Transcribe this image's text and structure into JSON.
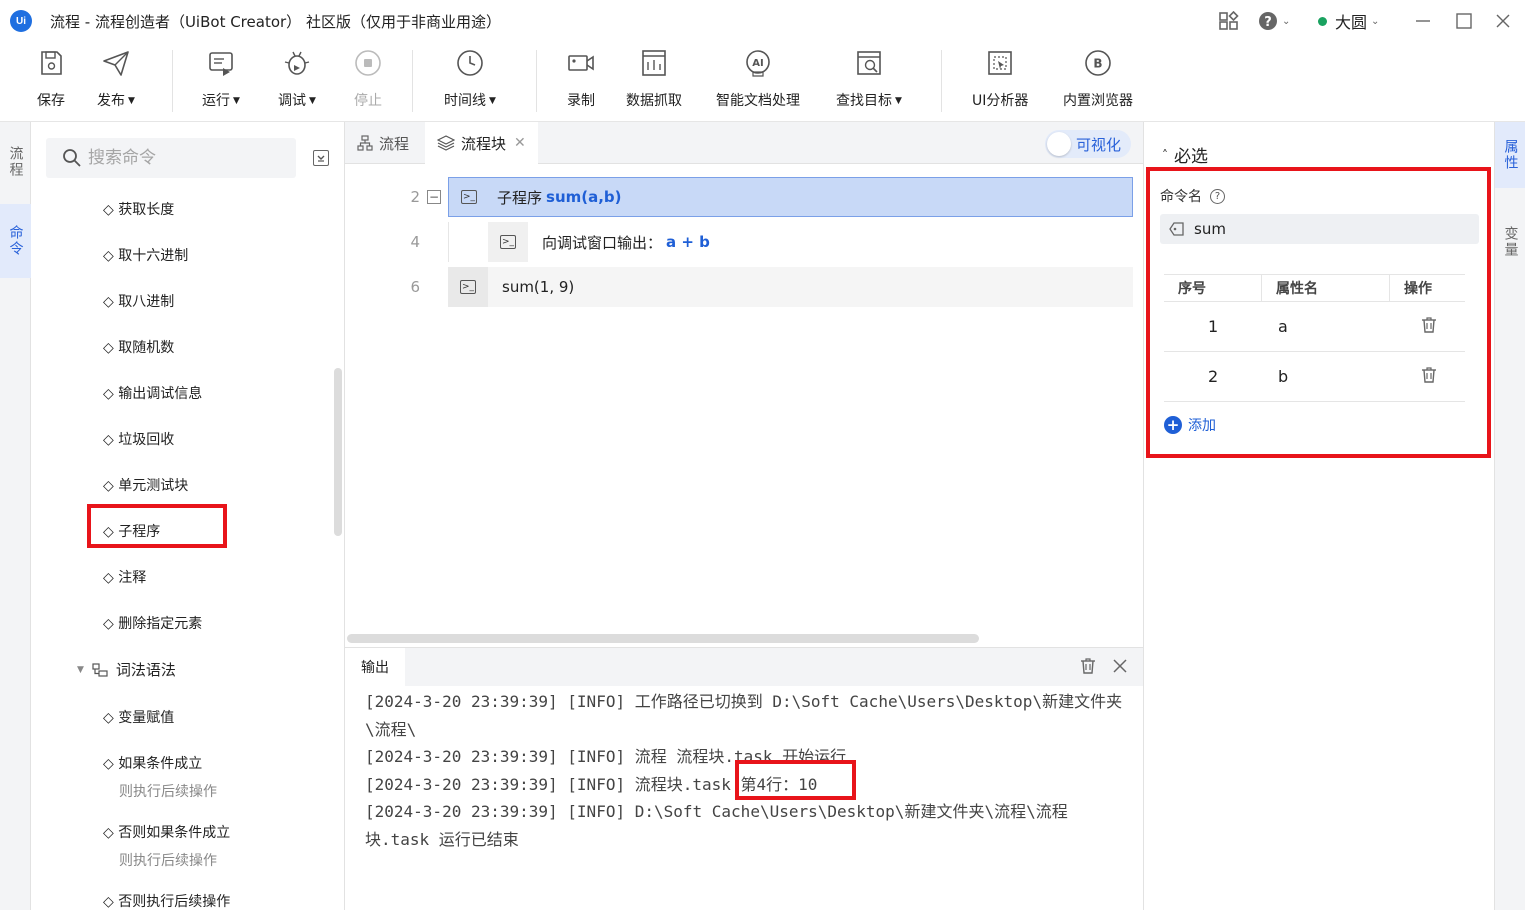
{
  "window": {
    "logo": "Ui",
    "title": "流程 - 流程创造者（UiBot Creator） 社区版（仅用于非商业用途）",
    "user": "大圆"
  },
  "toolbar": {
    "save": "保存",
    "publish": "发布",
    "run": "运行",
    "debug": "调试",
    "stop": "停止",
    "timeline": "时间线",
    "record": "录制",
    "data_scrape": "数据抓取",
    "smart_doc": "智能文档处理",
    "find_target": "查找目标",
    "ui_analyzer": "UI分析器",
    "browser": "内置浏览器"
  },
  "left_rail": {
    "flow": "流程",
    "command": "命令"
  },
  "commands": {
    "search_placeholder": "搜索命令",
    "items": [
      "◇ 获取长度",
      "◇ 取十六进制",
      "◇ 取八进制",
      "◇ 取随机数",
      "◇ 输出调试信息",
      "◇ 垃圾回收",
      "◇ 单元测试块",
      "◇ 子程序",
      "◇ 注释",
      "◇ 删除指定元素"
    ],
    "group": "词法语法",
    "group_items": [
      {
        "main": "◇ 变量赋值",
        "sub": ""
      },
      {
        "main": "◇ 如果条件成立",
        "sub": "则执行后续操作"
      },
      {
        "main": "◇ 否则如果条件成立",
        "sub": "则执行后续操作"
      },
      {
        "main": "◇ 否则执行后续操作",
        "sub": ""
      }
    ]
  },
  "editor": {
    "tab_flow": "流程",
    "tab_block": "流程块",
    "visual_toggle": "可视化",
    "lines": [
      {
        "num": "2",
        "label": "子程序",
        "code": "sum(a,b)"
      },
      {
        "num": "4",
        "label": "向调试窗口输出：",
        "code": "a + b"
      },
      {
        "num": "6",
        "label": "sum(1, 9)",
        "code": ""
      }
    ]
  },
  "output": {
    "tab": "输出",
    "logs": [
      "[2024-3-20 23:39:39] [INFO] 工作路径已切换到 D:\\Soft Cache\\Users\\Desktop\\新建文件夹\\流程\\",
      "[2024-3-20 23:39:39] [INFO] 流程 流程块.task 开始运行",
      "[2024-3-20 23:39:39] [INFO] 流程块.task 第4行：10",
      "[2024-3-20 23:39:39] [INFO] D:\\Soft Cache\\Users\\Desktop\\新建文件夹\\流程\\流程块.task 运行已结束"
    ]
  },
  "properties": {
    "section": "必选",
    "command_name_label": "命令名",
    "command_name_value": "sum",
    "table_headers": [
      "序号",
      "属性名",
      "操作"
    ],
    "rows": [
      {
        "index": "1",
        "name": "a"
      },
      {
        "index": "2",
        "name": "b"
      }
    ],
    "add_label": "添加"
  },
  "right_rail": {
    "properties": "属性",
    "variables": "变量"
  },
  "colors": {
    "accent": "#1f5fd6",
    "selection": "#c8d9f7",
    "annotation": "#e8141a",
    "status_online": "#1aa260"
  }
}
